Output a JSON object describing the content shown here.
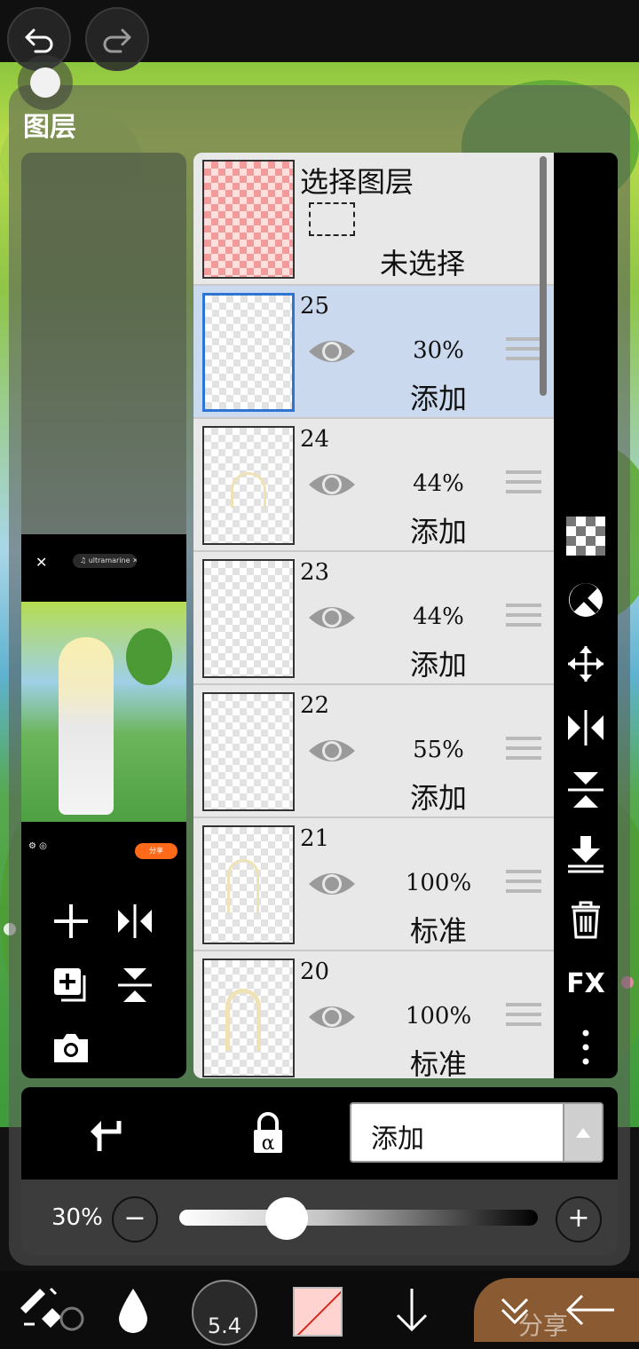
{
  "panel": {
    "title": "图层"
  },
  "selection_layer": {
    "title": "选择图层",
    "state": "未选择"
  },
  "layers": [
    {
      "number": "25",
      "opacity": "30%",
      "blend_mode": "添加",
      "selected": true
    },
    {
      "number": "24",
      "opacity": "44%",
      "blend_mode": "添加",
      "selected": false
    },
    {
      "number": "23",
      "opacity": "44%",
      "blend_mode": "添加",
      "selected": false
    },
    {
      "number": "22",
      "opacity": "55%",
      "blend_mode": "添加",
      "selected": false
    },
    {
      "number": "21",
      "opacity": "100%",
      "blend_mode": "标准",
      "selected": false
    },
    {
      "number": "20",
      "opacity": "100%",
      "blend_mode": "标准",
      "selected": false
    }
  ],
  "right_toolbar": {
    "fx_label": "FX"
  },
  "blend_bar": {
    "blend_mode": "添加"
  },
  "opacity_bar": {
    "value_label": "30%",
    "value": 0.3,
    "minus": "−",
    "plus": "+"
  },
  "bottom_toolbar": {
    "brush_size": "5.4",
    "watermark": "分享"
  },
  "thumbnail": {
    "close": "✕",
    "music_pill": "♫ ultramarine ✕",
    "share_button": "分享"
  },
  "colors": {
    "selected_row": "#cad9ee",
    "selected_border": "#2f74d0",
    "share_orange": "#ff6a1a"
  }
}
